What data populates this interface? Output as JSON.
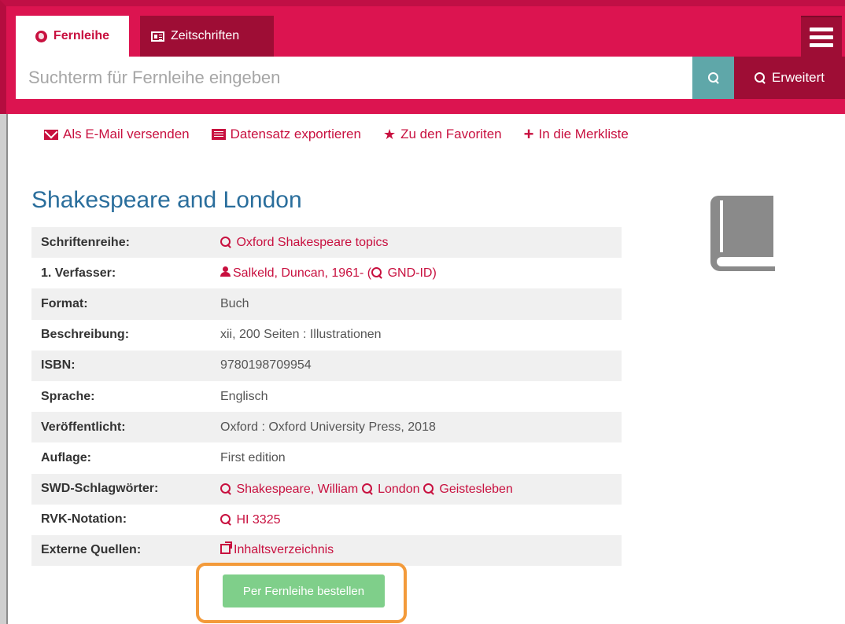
{
  "header": {
    "tabs": [
      {
        "label": "Fernleihe",
        "active": true
      },
      {
        "label": "Zeitschriften",
        "active": false
      }
    ],
    "search": {
      "placeholder": "Suchterm für Fernleihe eingeben",
      "value": ""
    },
    "advanced_label": "Erweitert"
  },
  "actions": [
    {
      "label": "Als E-Mail versenden",
      "icon": "envelope-icon"
    },
    {
      "label": "Datensatz exportieren",
      "icon": "list-icon"
    },
    {
      "label": "Zu den Favoriten",
      "icon": "star-icon"
    },
    {
      "label": "In die Merkliste",
      "icon": "plus-icon"
    }
  ],
  "record": {
    "title": "Shakespeare and London",
    "fields": {
      "series_label": "Schriftenreihe:",
      "series_value": "Oxford Shakespeare topics",
      "author_label": "1. Verfasser:",
      "author_value": "Salkeld, Duncan, 1961- (",
      "author_gnd": "GND-ID",
      "author_close": ")",
      "format_label": "Format:",
      "format_value": "Buch",
      "description_label": "Beschreibung:",
      "description_value": "xii, 200 Seiten : Illustrationen",
      "isbn_label": "ISBN:",
      "isbn_value": "9780198709954",
      "language_label": "Sprache:",
      "language_value": "Englisch",
      "published_label": "Veröffentlicht:",
      "published_value": "Oxford : Oxford University Press, 2018",
      "edition_label": "Auflage:",
      "edition_value": "First edition",
      "subjects_label": "SWD-Schlagwörter:",
      "subjects": [
        "Shakespeare, William",
        "London",
        "Geistesleben"
      ],
      "rvk_label": "RVK-Notation:",
      "rvk_value": "HI 3325",
      "external_label": "Externe Quellen:",
      "external_value": "Inhaltsverzeichnis"
    }
  },
  "order_button": "Per Fernleihe bestellen",
  "colors": {
    "brand": "#dc1450",
    "tab_dark": "#9e0d35",
    "search_button": "#5fa7a9",
    "title": "#2a6e9c",
    "link": "#c8103f",
    "order_button": "#7fcf8a",
    "highlight": "#f39a3a"
  }
}
